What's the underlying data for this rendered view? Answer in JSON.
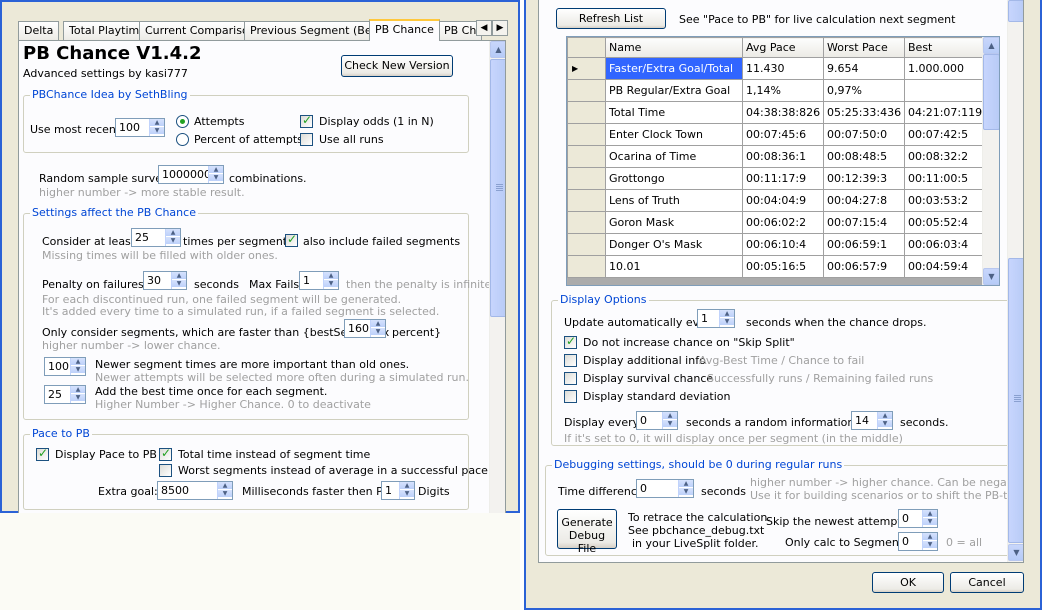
{
  "tabs": [
    "Delta",
    "Total Playtime",
    "Current Comparison",
    "Previous Segment (Best)",
    "PB Chance",
    "PB Cha"
  ],
  "header": {
    "title": "PB Chance V1.4.2",
    "subtitle": "Advanced settings by kasi777",
    "check_version_button": "Check New Version"
  },
  "idea_group": {
    "label": "PBChance Idea by SethBling",
    "use_most_recent_label": "Use most recent:",
    "use_most_recent_value": "100",
    "attempts_label": "Attempts",
    "percent_label": "Percent of attempts",
    "display_odds_label": "Display odds (1 in N)",
    "use_all_runs_label": "Use all runs"
  },
  "sample": {
    "label": "Random sample survey",
    "value": "1000000",
    "suffix": "combinations.",
    "hint": "higher number -> more stable result."
  },
  "settings_group": {
    "label": "Settings affect the PB Chance",
    "consider_label": "Consider at least",
    "consider_value": "25",
    "consider_suffix": "times per segment.",
    "include_failed_label": "also include failed segments",
    "missing_hint": "Missing times will be filled with older ones.",
    "penalty_label": "Penalty on failures",
    "penalty_value": "30",
    "penalty_unit": "seconds",
    "max_fails_label": "Max Fails",
    "max_fails_value": "1",
    "max_fails_hint": "then the penalty is infinite",
    "penalty_hint1": "For each discontinued run, one failed segment will be generated.",
    "penalty_hint2": "It's added every time to a simulated run, if a failed segment is selected.",
    "faster_label": "Only consider segments, which are faster than {bestSegm[s] x",
    "faster_value": "160",
    "faster_suffix": "percent}",
    "faster_hint": "higher number -> lower chance.",
    "newer_value": "100",
    "newer_label": "Newer segment times are more important than old ones.",
    "newer_hint": "Newer attempts will be selected more often during a simulated run.",
    "best_value": "25",
    "best_label": "Add the best time once for each segment.",
    "best_hint": "Higher Number -> Higher Chance. 0 to deactivate"
  },
  "pace_group": {
    "label": "Pace to PB",
    "display_pace_label": "Display Pace to PB",
    "total_time_label": "Total time instead of segment time",
    "worst_segments_label": "Worst segments instead of average in a successful pace",
    "extra_goal_label": "Extra goal:",
    "extra_goal_value": "8500",
    "ms_faster_label": "Milliseconds faster then PB",
    "digits_value": "1",
    "digits_label": "Digits"
  },
  "right": {
    "refresh_button": "Refresh List",
    "refresh_hint": "See \"Pace to PB\" for live calculation next segment",
    "table": {
      "columns": [
        "Name",
        "Avg Pace",
        "Worst Pace",
        "Best"
      ],
      "rows": [
        [
          "Faster/Extra Goal/Total",
          "11.430",
          "9.654",
          "1.000.000"
        ],
        [
          "PB Regular/Extra Goal",
          "1,14%",
          "0,97%",
          ""
        ],
        [
          "Total Time",
          "04:38:38:826",
          "05:25:33:436",
          "04:21:07:119"
        ],
        [
          "Enter Clock Town",
          "00:07:45:6",
          "00:07:50:0",
          "00:07:42:5"
        ],
        [
          "Ocarina of Time",
          "00:08:36:1",
          "00:08:48:5",
          "00:08:32:2"
        ],
        [
          "Grottongo",
          "00:11:17:9",
          "00:12:39:3",
          "00:11:00:5"
        ],
        [
          "Lens of Truth",
          "00:04:04:9",
          "00:04:27:8",
          "00:03:53:2"
        ],
        [
          "Goron Mask",
          "00:06:02:2",
          "00:07:15:4",
          "00:05:52:4"
        ],
        [
          "Donger O's Mask",
          "00:06:10:4",
          "00:06:59:1",
          "00:06:03:4"
        ],
        [
          "10.01",
          "00:05:16:5",
          "00:06:57:9",
          "00:04:59:4"
        ]
      ]
    },
    "display_group": {
      "label": "Display Options",
      "update_label": "Update automatically every",
      "update_value": "1",
      "update_suffix": "seconds when the chance drops.",
      "skip_split_label": "Do not increase chance on \"Skip Split\"",
      "additional_label": "Display additional info",
      "additional_hint": "Avg-Best Time / Chance to fail",
      "survival_label": "Display survival chance",
      "survival_hint": "Successfully runs / Remaining failed runs",
      "stddev_label": "Display standard deviation",
      "display_every_label": "Display every",
      "display_every_value": "0",
      "random_info_label": "seconds a random information for",
      "random_info_value": "14",
      "random_info_suffix": "seconds.",
      "display_hint": "If it's set to 0, it will display once per segment (in the middle)"
    },
    "debug_group": {
      "label": "Debugging settings, should be 0 during regular runs",
      "time_diff_label": "Time difference",
      "time_diff_value": "0",
      "time_diff_unit": "seconds",
      "time_diff_hint1": "higher number -> higher chance. Can be negative.",
      "time_diff_hint2": "Use it for building scenarios or to shift the PB-time.",
      "generate_line1": "Generate",
      "generate_line2": "Debug File",
      "retrace_line1": "To retrace the calculation.",
      "retrace_line2": "See pbchance_debug.txt",
      "retrace_line3": "in your LiveSplit folder.",
      "skip_newest_label": "Skip the newest attempts:",
      "skip_newest_value": "0",
      "only_calc_label": "Only calc to Segment:",
      "only_calc_value": "0",
      "only_calc_hint": "0 = all"
    },
    "ok_button": "OK",
    "cancel_button": "Cancel"
  }
}
